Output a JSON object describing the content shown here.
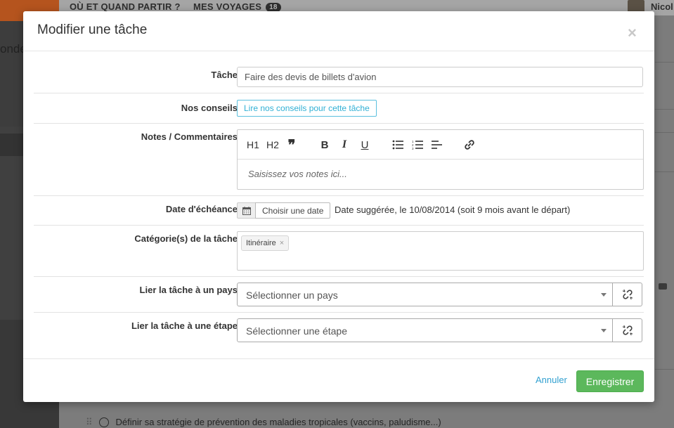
{
  "background": {
    "nav_where": "OÙ ET QUAND PARTIR ?",
    "nav_trips": "MES VOYAGES",
    "trips_count": "18",
    "user_name": "Nicol",
    "side_text": "onde",
    "bottom_task": "Définir sa stratégie de prévention des maladies tropicales (vaccins, paludisme...)"
  },
  "modal": {
    "title": "Modifier une tâche",
    "close_symbol": "×",
    "task": {
      "label": "Tâche",
      "value": "Faire des devis de billets d'avion"
    },
    "advice": {
      "label": "Nos conseils",
      "button": "Lire nos conseils pour cette tâche"
    },
    "notes": {
      "label": "Notes / Commentaires",
      "placeholder": "Saisissez vos notes ici...",
      "toolbar": {
        "h1": "H1",
        "h2": "H2",
        "quote": "❞",
        "bold": "B",
        "italic": "I",
        "underline": "U"
      }
    },
    "due_date": {
      "label": "Date d'échéance",
      "button": "Choisir une date",
      "hint": "Date suggérée, le 10/08/2014 (soit 9 mois avant le départ)"
    },
    "categories": {
      "label": "Catégorie(s) de la tâche",
      "tags": [
        "Itinéraire"
      ],
      "remove_symbol": "×"
    },
    "country": {
      "label": "Lier la tâche à un pays",
      "placeholder": "Sélectionner un pays"
    },
    "stage": {
      "label": "Lier la tâche à une étape",
      "placeholder": "Sélectionner une étape"
    },
    "footer": {
      "cancel": "Annuler",
      "save": "Enregistrer"
    }
  },
  "colors": {
    "save_green": "#5cb85c",
    "link_blue": "#31a0d0",
    "advice_border": "#5bc0de",
    "overlay_orange": "#b5541e"
  }
}
